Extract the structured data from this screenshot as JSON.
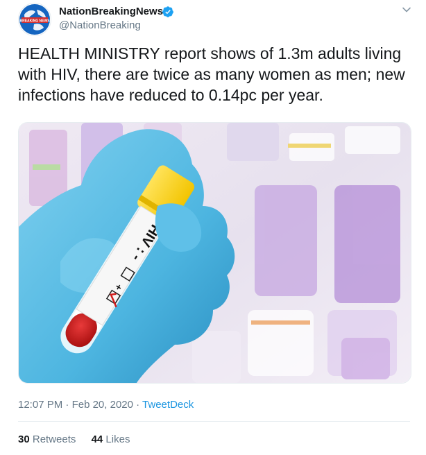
{
  "account": {
    "display_name": "NationBreakingNews",
    "handle": "@NationBreaking",
    "verified": true,
    "avatar_text": "BREAKING NEWS"
  },
  "tweet": {
    "text": "HEALTH MINISTRY report shows of 1.3m adults living with HIV, there are twice as many women as men; new infections have reduced to 0.14pc per year."
  },
  "media": {
    "tube_label": "HIV : -",
    "tube_plus": "+"
  },
  "meta": {
    "time": "12:07 PM",
    "separator": "·",
    "date": "Feb 20, 2020",
    "source": "TweetDeck"
  },
  "stats": {
    "retweets_count": "30",
    "retweets_label": "Retweets",
    "likes_count": "44",
    "likes_label": "Likes"
  },
  "colors": {
    "verified_blue": "#1da1f2",
    "link_blue": "#1b95e0",
    "secondary_text": "#657786"
  },
  "icons": [
    "globe-avatar-icon",
    "verified-badge-icon",
    "chevron-down-icon"
  ]
}
